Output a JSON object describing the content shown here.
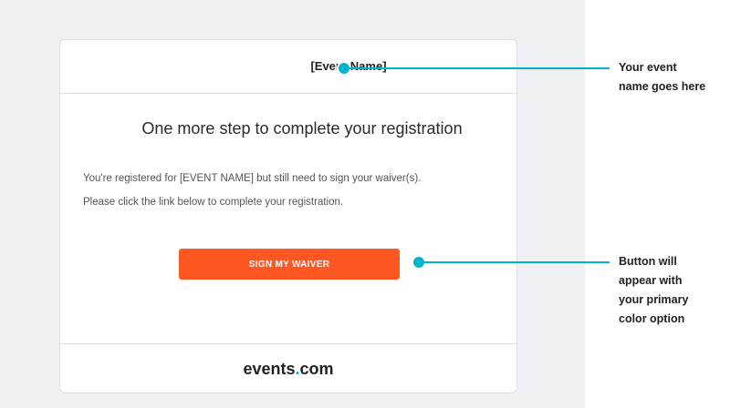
{
  "email": {
    "event_name": "[Event Name]",
    "headline": "One more step to complete your registration",
    "body_line_1": "You're registered for [EVENT NAME] but still need to sign your waiver(s).",
    "body_line_2": "Please click the link below to complete your registration.",
    "button_label": "SIGN MY WAIVER",
    "brand_part_1": "events",
    "brand_dot": ".",
    "brand_part_2": "com"
  },
  "callouts": {
    "event_name_note": [
      "Your event",
      "name goes here"
    ],
    "button_note": [
      "Button will",
      "appear with",
      "your primary",
      "color option"
    ]
  },
  "colors": {
    "primary": "#ff5722",
    "accent": "#00b4cc",
    "panel_bg": "#eef0f3"
  }
}
